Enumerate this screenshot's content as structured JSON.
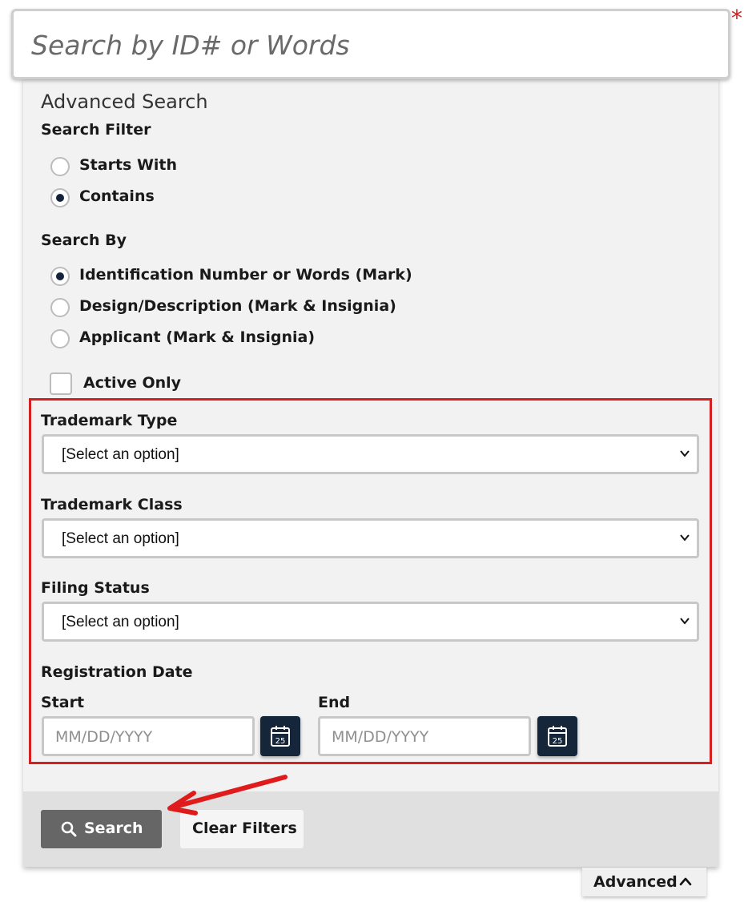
{
  "search": {
    "placeholder": "Search by ID# or Words",
    "required_marker": "*"
  },
  "advanced": {
    "title": "Advanced Search",
    "search_filter": {
      "label": "Search Filter",
      "options": [
        {
          "label": "Starts With",
          "checked": false
        },
        {
          "label": "Contains",
          "checked": true
        }
      ]
    },
    "search_by": {
      "label": "Search By",
      "options": [
        {
          "label": "Identification Number or Words (Mark)",
          "checked": true
        },
        {
          "label": "Design/Description (Mark & Insignia)",
          "checked": false
        },
        {
          "label": "Applicant (Mark & Insignia)",
          "checked": false
        }
      ]
    },
    "active_only": {
      "label": "Active Only",
      "checked": false
    },
    "trademark_type": {
      "label": "Trademark Type",
      "value": "[Select an option]"
    },
    "trademark_class": {
      "label": "Trademark Class",
      "value": "[Select an option]"
    },
    "filing_status": {
      "label": "Filing Status",
      "value": "[Select an option]"
    },
    "registration_date": {
      "label": "Registration Date",
      "start_label": "Start",
      "end_label": "End",
      "start_placeholder": "MM/DD/YYYY",
      "end_placeholder": "MM/DD/YYYY",
      "calendar_day": "25"
    }
  },
  "actions": {
    "search_label": "Search",
    "clear_label": "Clear Filters"
  },
  "toggle": {
    "label": "Advanced"
  },
  "colors": {
    "accent": "#15263b",
    "highlight": "#d62020",
    "search_button": "#666666"
  }
}
